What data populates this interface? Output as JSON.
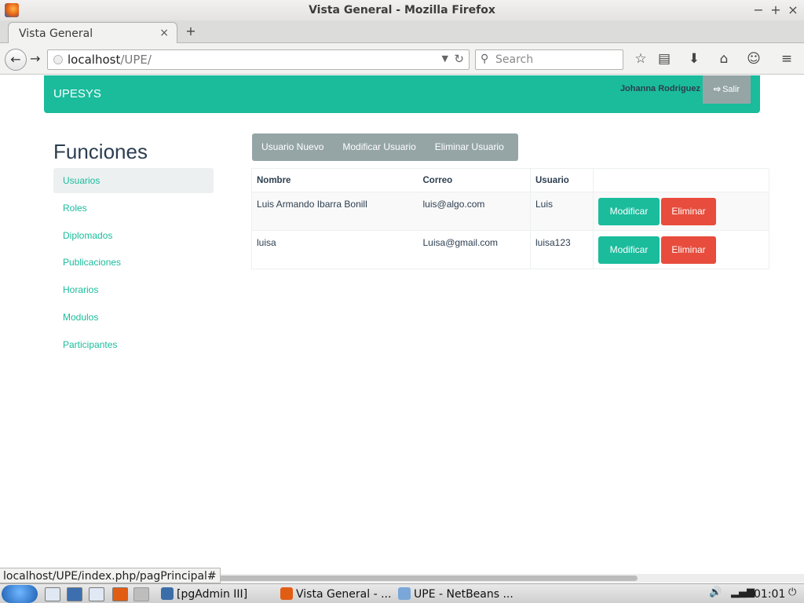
{
  "window": {
    "title": "Vista General - Mozilla Firefox",
    "controls": {
      "minimize": "−",
      "maximize": "+",
      "close": "×"
    }
  },
  "browser": {
    "tab_label": "Vista General",
    "tab_close": "×",
    "new_tab": "+",
    "url_host": "localhost",
    "url_path": "/UPE/",
    "search_placeholder": "Search",
    "status_url": "localhost/UPE/index.php/pagPrincipal#"
  },
  "header": {
    "brand": "UPESYS",
    "user_name": "Johanna Rodriguez",
    "logout_label": "Salir"
  },
  "sidebar": {
    "title": "Funciones",
    "items": [
      {
        "label": "Usuarios"
      },
      {
        "label": "Roles"
      },
      {
        "label": "Diplomados"
      },
      {
        "label": "Publicaciones"
      },
      {
        "label": "Horarios"
      },
      {
        "label": "Modulos"
      },
      {
        "label": "Participantes"
      }
    ]
  },
  "actions": {
    "new_user": "Usuario Nuevo",
    "modify_user": "Modificar Usuario",
    "delete_user": "Eliminar Usuario"
  },
  "table": {
    "headers": [
      "Nombre",
      "Correo",
      "Usuario",
      ""
    ],
    "rows": [
      {
        "nombre": "Luis Armando Ibarra Bonill",
        "correo": "luis@algo.com",
        "usuario": "Luis"
      },
      {
        "nombre": "luisa",
        "correo": "Luisa@gmail.com",
        "usuario": "luisa123"
      }
    ],
    "modify_label": "Modificar",
    "delete_label": "Eliminar"
  },
  "taskbar": {
    "tasks": [
      {
        "label": "[pgAdmin III]"
      },
      {
        "label": "Vista General - ..."
      },
      {
        "label": "UPE - NetBeans ..."
      }
    ],
    "clock": "01:01"
  },
  "colors": {
    "accent": "#1abc9c",
    "danger": "#e74c3c",
    "muted": "#95a5a6",
    "text": "#2c3e50"
  }
}
